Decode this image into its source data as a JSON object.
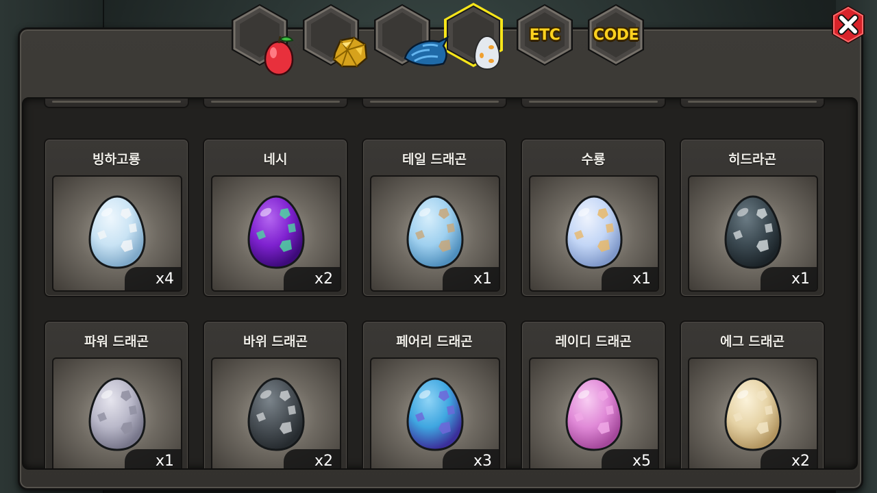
{
  "tabs": [
    {
      "name": "fruit",
      "icon": "fruit-icon",
      "label": ""
    },
    {
      "name": "ore",
      "icon": "gold-ore-icon",
      "label": ""
    },
    {
      "name": "material",
      "icon": "dragon-scale-icon",
      "label": ""
    },
    {
      "name": "egg",
      "icon": "egg-icon",
      "label": "",
      "active": true
    },
    {
      "name": "etc",
      "icon": "",
      "label": "ETC"
    },
    {
      "name": "code",
      "icon": "",
      "label": "CODE"
    }
  ],
  "close_icon": "close-icon",
  "eggs": [
    {
      "name": "빙하고룡",
      "count": "x4",
      "colors": {
        "base": "#c9e3f4",
        "light": "#eef7fd",
        "dark": "#7fa9c9",
        "spot": "#f3f6f8"
      }
    },
    {
      "name": "네시",
      "count": "x2",
      "colors": {
        "base": "#7f22d0",
        "light": "#b466f0",
        "dark": "#3d0a7a",
        "spot": "#4fd6a0"
      }
    },
    {
      "name": "테일 드래곤",
      "count": "x1",
      "colors": {
        "base": "#9fd0ef",
        "light": "#d6eefb",
        "dark": "#4f8fbd",
        "spot": "#c8a77a"
      }
    },
    {
      "name": "수룡",
      "count": "x1",
      "colors": {
        "base": "#c3d6f6",
        "light": "#eef3fd",
        "dark": "#7f98c9",
        "spot": "#e8b86a"
      }
    },
    {
      "name": "히드라곤",
      "count": "x1",
      "colors": {
        "base": "#3c4a52",
        "light": "#6b7b84",
        "dark": "#1c2429",
        "spot": "#cfd6d8"
      }
    },
    {
      "name": "파워 드래곤",
      "count": "x1",
      "colors": {
        "base": "#b9b8c9",
        "light": "#e6e5ee",
        "dark": "#77768a",
        "spot": "#8f8ea0"
      }
    },
    {
      "name": "바위 드래곤",
      "count": "x2",
      "colors": {
        "base": "#4b5258",
        "light": "#7b848b",
        "dark": "#262b2f",
        "spot": "#c9cdcf"
      }
    },
    {
      "name": "페어리 드래곤",
      "count": "x3",
      "colors": {
        "base": "#3fa6e0",
        "light": "#8fd4f6",
        "dark": "#3b2f9a",
        "spot": "#6e66d8"
      }
    },
    {
      "name": "레이디 드래곤",
      "count": "x5",
      "colors": {
        "base": "#e089d7",
        "light": "#f8ccf2",
        "dark": "#a4489b",
        "spot": "#f0a8e6"
      }
    },
    {
      "name": "에그 드래곤",
      "count": "x2",
      "colors": {
        "base": "#e6d3a6",
        "light": "#fbf2d9",
        "dark": "#b29560",
        "spot": "#f1e4c3"
      }
    }
  ]
}
